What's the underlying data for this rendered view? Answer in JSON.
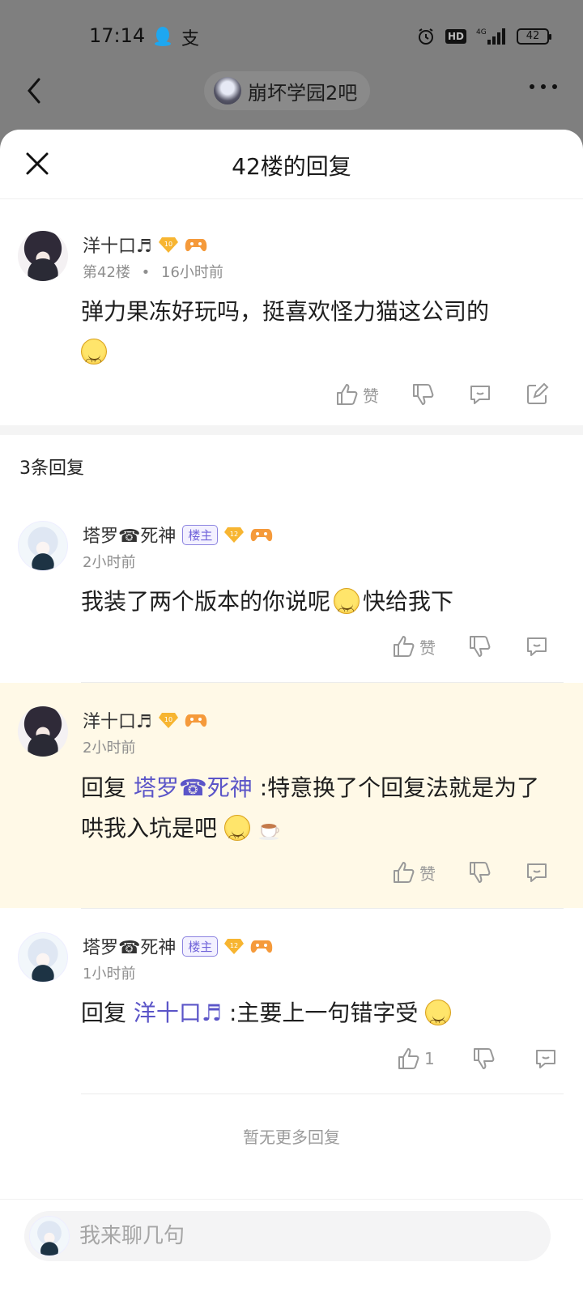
{
  "status_bar": {
    "time": "17:14",
    "pay_icon": "支",
    "hd": "HD",
    "network": "4G",
    "battery": "42"
  },
  "top_nav": {
    "forum_name": "崩坏学园2吧"
  },
  "sheet": {
    "title": "42楼的回复"
  },
  "main_post": {
    "username": "洋十口♬",
    "level": "10",
    "floor": "第42楼",
    "separator": "•",
    "time": "16小时前",
    "text": "弹力果冻好玩吗，挺喜欢怪力猫这公司的",
    "like_label": "赞"
  },
  "reply_count": "3条回复",
  "replies": [
    {
      "username": "塔罗☎死神",
      "badge": "楼主",
      "level": "12",
      "time": "2小时前",
      "text_a": "我装了两个版本的你说呢",
      "text_b": "快给我下",
      "like_label": "赞"
    },
    {
      "username": "洋十口♬",
      "level": "10",
      "time": "2小时前",
      "prefix": "回复",
      "mention": "塔罗☎死神",
      "text": ":特意换了个回复法就是为了哄我入坑是吧",
      "like_label": "赞"
    },
    {
      "username": "塔罗☎死神",
      "badge": "楼主",
      "level": "12",
      "time": "1小时前",
      "prefix": "回复",
      "mention": "洋十口♬",
      "text": ":主要上一句错字受",
      "like_label": "1"
    }
  ],
  "no_more": "暂无更多回复",
  "input": {
    "placeholder": "我来聊几句"
  },
  "colors": {
    "accent": "#5b55c8",
    "highlight_bg": "#fff9e7",
    "meta": "#8e8e8e"
  }
}
